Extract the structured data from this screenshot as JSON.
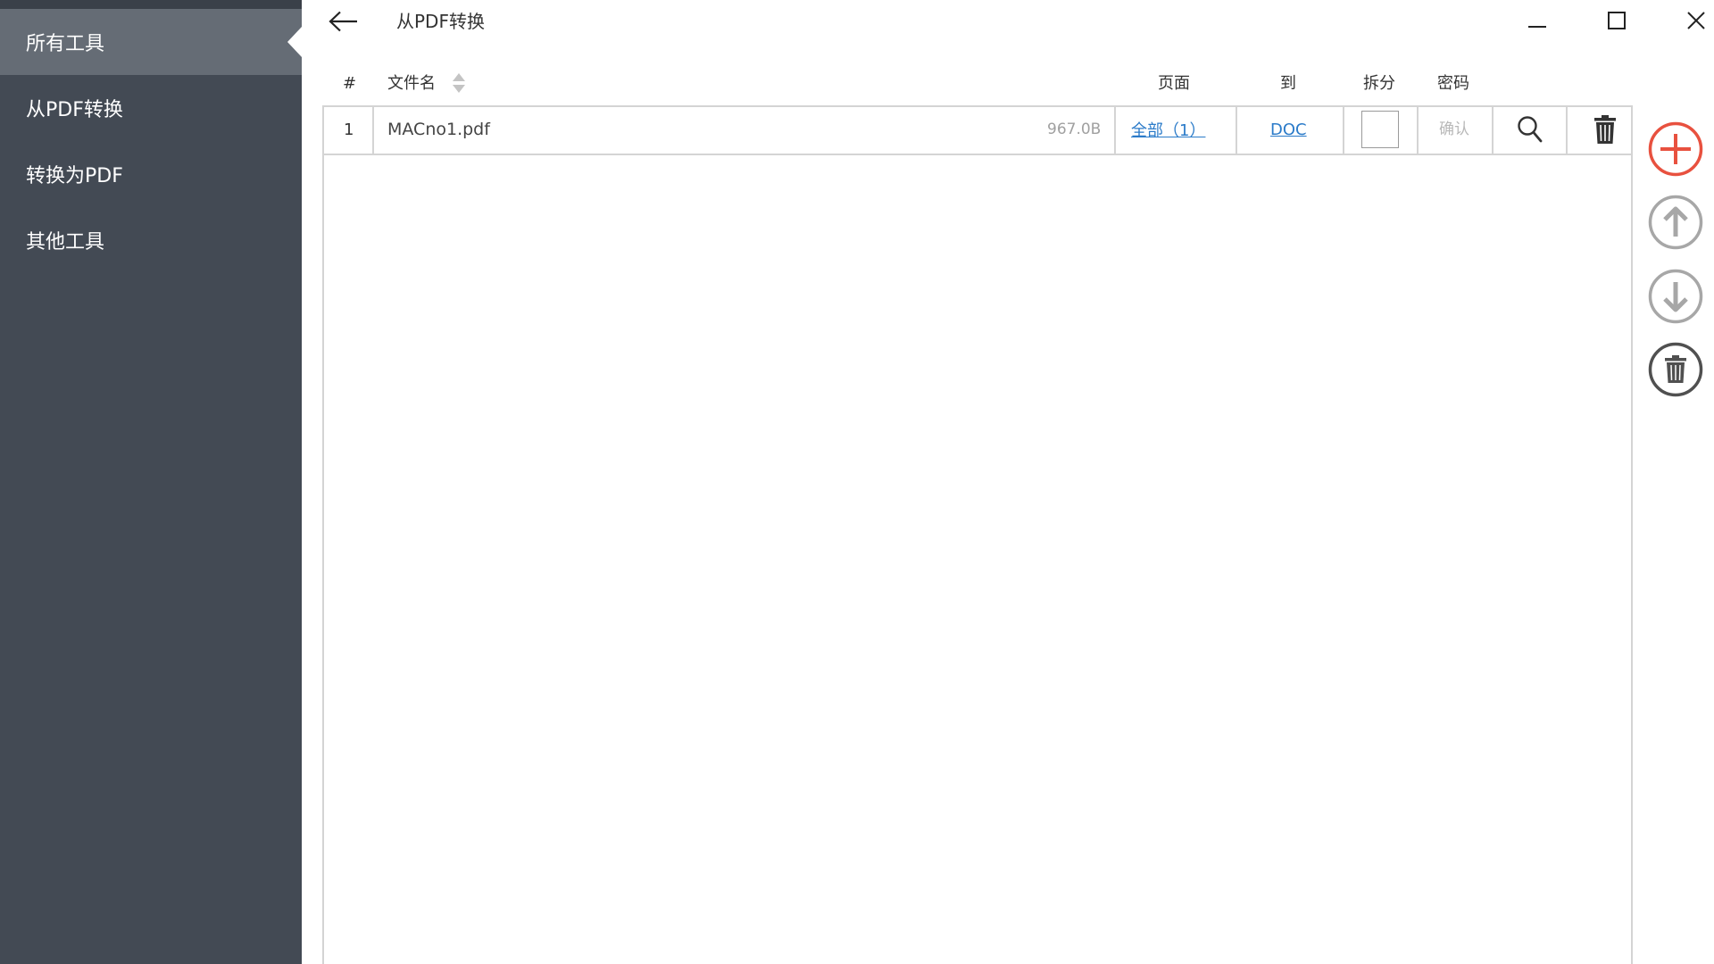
{
  "sidebar": {
    "items": [
      {
        "label": "所有工具",
        "active": true
      },
      {
        "label": "从PDF转换",
        "active": false
      },
      {
        "label": "转换为PDF",
        "active": false
      },
      {
        "label": "其他工具",
        "active": false
      }
    ]
  },
  "header": {
    "title": "从PDF转换",
    "back_icon": "arrow-left-icon",
    "window_controls": [
      "minimize-icon",
      "maximize-icon",
      "close-icon"
    ]
  },
  "table": {
    "columns": {
      "index": "#",
      "filename": "文件名",
      "pages": "页面",
      "to": "到",
      "split": "拆分",
      "password": "密码"
    },
    "rows": [
      {
        "index": "1",
        "filename": "MACno1.pdf",
        "size": "967.0B",
        "pages": "全部（1）",
        "to": "DOC",
        "split": false,
        "password_placeholder": "确认"
      }
    ]
  },
  "side_actions": [
    "add-icon",
    "move-up-icon",
    "move-down-icon",
    "trash-icon"
  ],
  "colors": {
    "sidebar_bg": "#434a54",
    "sidebar_active": "#656c75",
    "accent_red": "#e8513f",
    "link_blue": "#2b7bc9",
    "border": "#d4d4d4"
  }
}
